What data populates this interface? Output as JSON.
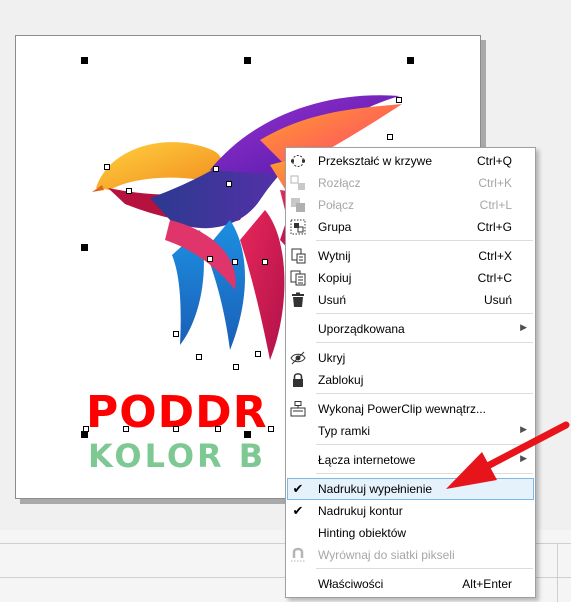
{
  "logo": {
    "title": "PODDR",
    "subtitle": "KOLOR B",
    "title_color": "#ff0000",
    "subtitle_color": "#7ec894"
  },
  "context_menu": {
    "items": [
      {
        "label": "Przekształć w krzywe",
        "shortcut": "Ctrl+Q",
        "enabled": true,
        "icon": "convert-to-curves-icon"
      },
      {
        "label": "Rozłącz",
        "shortcut": "Ctrl+K",
        "enabled": false,
        "icon": "break-apart-icon"
      },
      {
        "label": "Połącz",
        "shortcut": "Ctrl+L",
        "enabled": false,
        "icon": "combine-icon"
      },
      {
        "label": "Grupa",
        "shortcut": "Ctrl+G",
        "enabled": true,
        "icon": "group-icon"
      },
      {
        "label": "Wytnij",
        "shortcut": "Ctrl+X",
        "enabled": true,
        "icon": "cut-icon"
      },
      {
        "label": "Kopiuj",
        "shortcut": "Ctrl+C",
        "enabled": true,
        "icon": "copy-icon"
      },
      {
        "label": "Usuń",
        "shortcut": "Usuń",
        "enabled": true,
        "icon": "trash-icon"
      },
      {
        "label": "Uporządkowana",
        "shortcut": "",
        "enabled": true,
        "submenu": true
      },
      {
        "label": "Ukryj",
        "shortcut": "",
        "enabled": true,
        "icon": "hide-eye-icon"
      },
      {
        "label": "Zablokuj",
        "shortcut": "",
        "enabled": true,
        "icon": "lock-icon"
      },
      {
        "label": "Wykonaj PowerClip wewnątrz...",
        "shortcut": "",
        "enabled": true,
        "icon": "powerclip-icon"
      },
      {
        "label": "Typ ramki",
        "shortcut": "",
        "enabled": true,
        "submenu": true
      },
      {
        "label": "Łącza internetowe",
        "shortcut": "",
        "enabled": true,
        "submenu": true
      },
      {
        "label": "Nadrukuj wypełnienie",
        "shortcut": "",
        "enabled": true,
        "checked": true,
        "highlighted": true
      },
      {
        "label": "Nadrukuj kontur",
        "shortcut": "",
        "enabled": true,
        "checked": true
      },
      {
        "label": "Hinting obiektów",
        "shortcut": "",
        "enabled": true
      },
      {
        "label": "Wyrównaj do siatki pikseli",
        "shortcut": "",
        "enabled": false,
        "icon": "pixel-snap-icon"
      },
      {
        "label": "Właściwości",
        "shortcut": "Alt+Enter",
        "enabled": true
      }
    ]
  },
  "colors": {
    "highlight_bg": "#e5f1fb",
    "highlight_border": "#7fb7e6",
    "annotation_arrow": "#e8141b"
  }
}
